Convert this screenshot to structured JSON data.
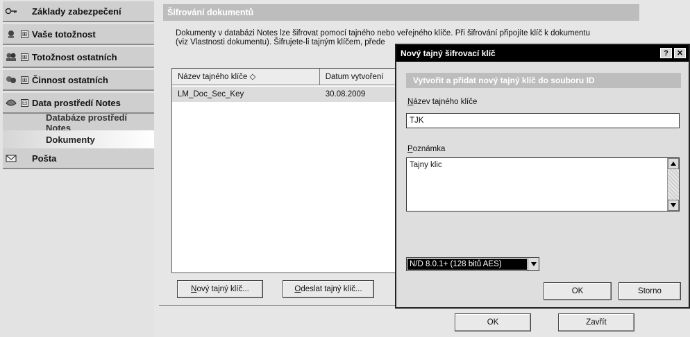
{
  "sidebar": {
    "items": [
      {
        "label": "Základy zabezpečení",
        "icon": "key-icon"
      },
      {
        "label": "Vaše totožnost",
        "icon": "id-card-icon",
        "expand": "⊞"
      },
      {
        "label": "Totožnost ostatních",
        "icon": "people-icon",
        "expand": "⊞"
      },
      {
        "label": "Činnost ostatních",
        "icon": "activity-icon",
        "expand": "⊞"
      },
      {
        "label": "Data prostředí Notes",
        "icon": "data-icon",
        "expand": "⊟"
      }
    ],
    "subitems": [
      {
        "label": "Databáze prostředí Notes"
      },
      {
        "label": "Dokumenty"
      }
    ],
    "mail": {
      "label": "Pošta",
      "icon": "mail-icon"
    }
  },
  "main": {
    "section_title": "Šifrování dokumentů",
    "description_line1": "Dokumenty v databázi Notes lze šifrovat pomocí tajného nebo veřejného klíče. Při šifrování připojíte klíč k dokumentu",
    "description_line2": "(viz Vlastnosti dokumentu). Šifrujete-li tajným klíčem, přede",
    "table": {
      "columns": [
        "Název tajného klíče ◇",
        "Datum vytvoření"
      ],
      "rows": [
        [
          "LM_Doc_Sec_Key",
          "30.08.2009"
        ]
      ]
    },
    "buttons": {
      "new_key_u": "N",
      "new_key_rest": "ový tajný klíč...",
      "send_key_u": "O",
      "send_key_rest": "deslat tajný klíč...",
      "ok": "OK",
      "close": "Zavřít"
    }
  },
  "dialog": {
    "title": "Nový tajný šifrovací klíč",
    "help": "?",
    "close": "✕",
    "header": "Vytvořit a přidat nový tajný klíč do souboru ID",
    "name_label_u": "N",
    "name_label_rest": "ázev tajného klíče",
    "name_value": "TJK",
    "note_label_u": "P",
    "note_label_rest": "oznámka",
    "note_value": "Tajny klic",
    "encryption_option": "N/D 8.0.1+ (128 bitů AES)",
    "ok": "OK",
    "cancel": "Storno"
  }
}
